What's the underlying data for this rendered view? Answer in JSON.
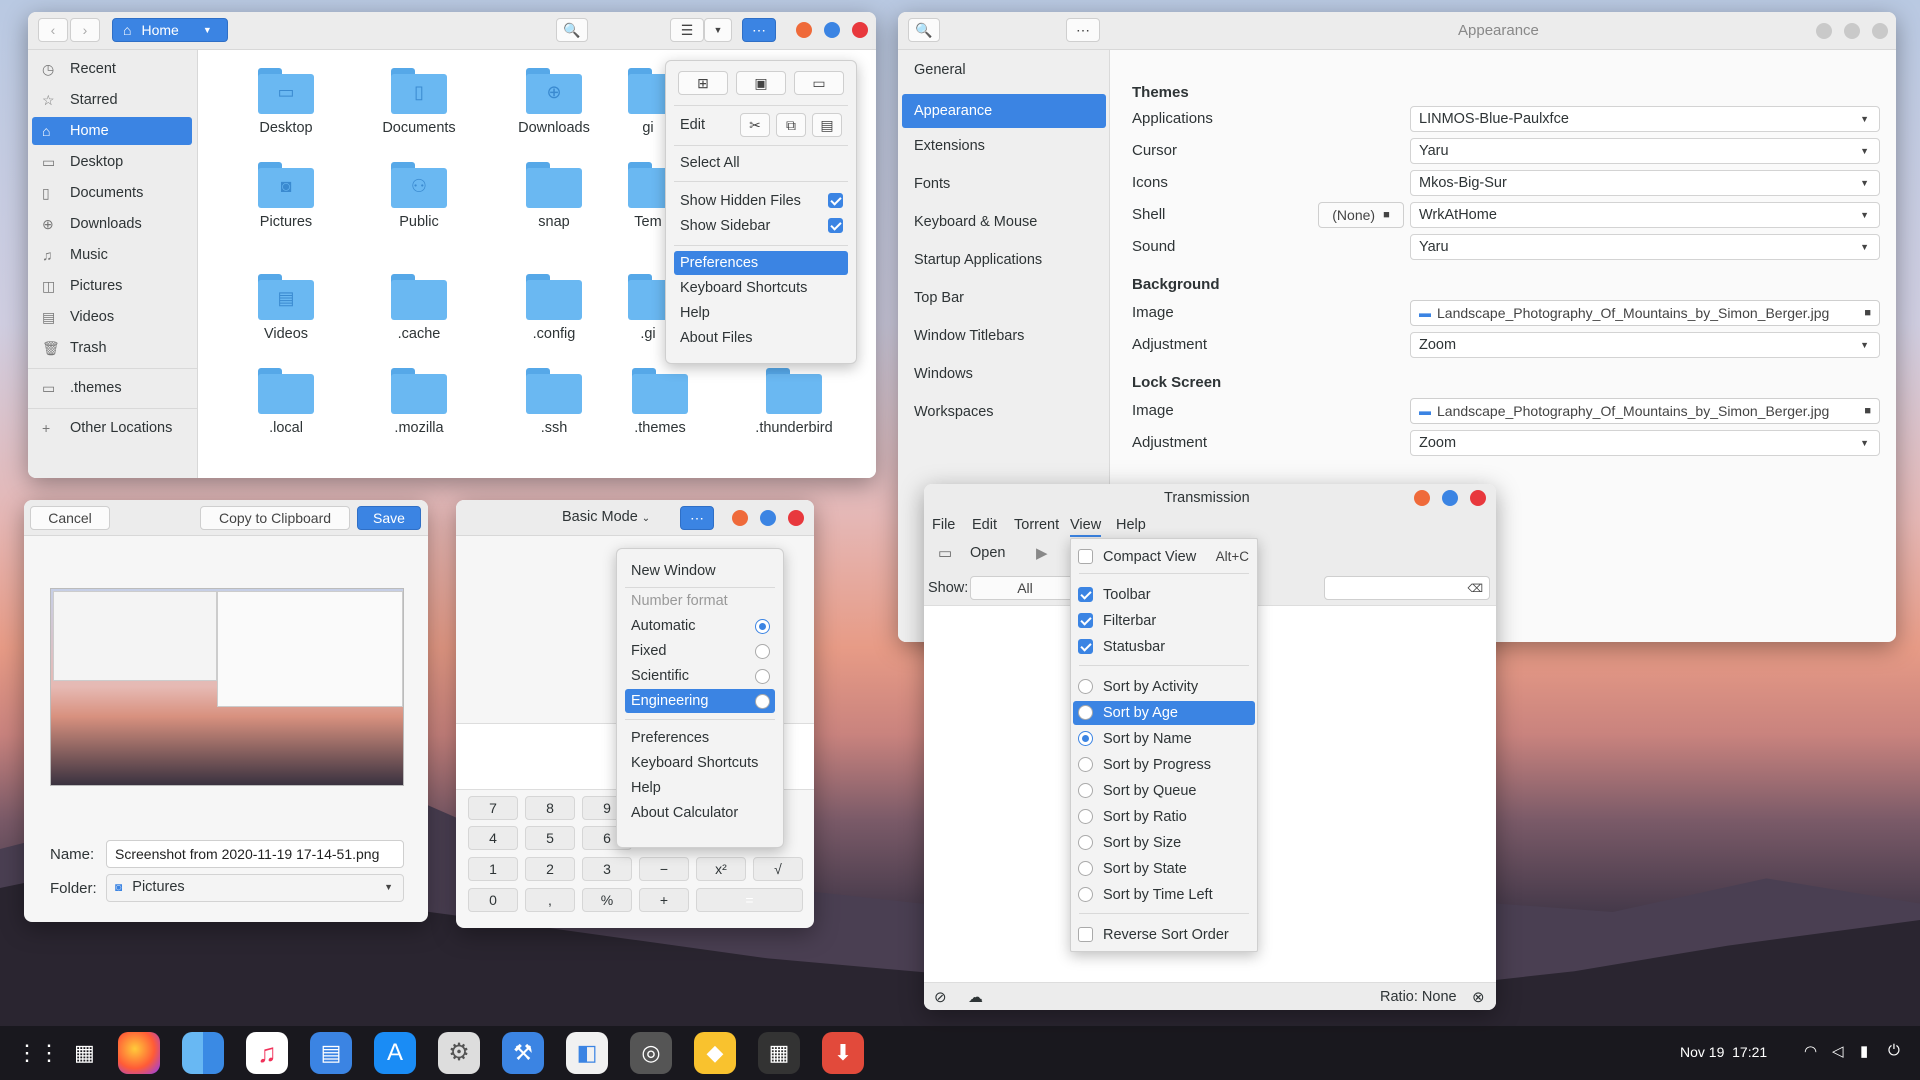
{
  "files": {
    "path_label": "Home",
    "sidebar": [
      {
        "icon": "clock-icon",
        "label": "Recent"
      },
      {
        "icon": "star-icon",
        "label": "Starred"
      },
      {
        "icon": "home-icon",
        "label": "Home"
      },
      {
        "icon": "desktop-icon",
        "label": "Desktop"
      },
      {
        "icon": "document-icon",
        "label": "Documents"
      },
      {
        "icon": "download-icon",
        "label": "Downloads"
      },
      {
        "icon": "music-icon",
        "label": "Music"
      },
      {
        "icon": "camera-icon",
        "label": "Pictures"
      },
      {
        "icon": "film-icon",
        "label": "Videos"
      },
      {
        "icon": "trash-icon",
        "label": "Trash"
      },
      {
        "icon": "folder-icon",
        "label": ".themes"
      },
      {
        "icon": "plus-icon",
        "label": "Other Locations"
      }
    ],
    "folders": [
      "Desktop",
      "Documents",
      "Downloads",
      "gi",
      "Pictures",
      "Public",
      "snap",
      "Tem",
      "Videos",
      ".cache",
      ".config",
      ".gi",
      ".local",
      ".mozilla",
      ".ssh",
      ".themes",
      ".thunderbird"
    ],
    "menu": {
      "edit": "Edit",
      "select_all": "Select All",
      "show_hidden": "Show Hidden Files",
      "show_sidebar": "Show Sidebar",
      "preferences": "Preferences",
      "shortcuts": "Keyboard Shortcuts",
      "help": "Help",
      "about": "About Files"
    }
  },
  "appearance": {
    "title": "Appearance",
    "nav": [
      "General",
      "Appearance",
      "Extensions",
      "Fonts",
      "Keyboard & Mouse",
      "Startup Applications",
      "Top Bar",
      "Window Titlebars",
      "Windows",
      "Workspaces"
    ],
    "themes_heading": "Themes",
    "applications_label": "Applications",
    "applications_value": "LINMOS-Blue-Paulxfce",
    "cursor_label": "Cursor",
    "cursor_value": "Yaru",
    "icons_label": "Icons",
    "icons_value": "Mkos-Big-Sur",
    "shell_label": "Shell",
    "shell_none": "(None)",
    "shell_value": "WrkAtHome",
    "sound_label": "Sound",
    "sound_value": "Yaru",
    "background_heading": "Background",
    "bg_image_label": "Image",
    "bg_image_value": "Landscape_Photography_Of_Mountains_by_Simon_Berger.jpg",
    "bg_adj_label": "Adjustment",
    "bg_adj_value": "Zoom",
    "lock_heading": "Lock Screen",
    "lock_image_label": "Image",
    "lock_image_value": "Landscape_Photography_Of_Mountains_by_Simon_Berger.jpg",
    "lock_adj_label": "Adjustment",
    "lock_adj_value": "Zoom"
  },
  "screenshot": {
    "cancel": "Cancel",
    "copy": "Copy to Clipboard",
    "save": "Save",
    "name_label": "Name:",
    "name_value": "Screenshot from 2020-11-19 17-14-51.png",
    "folder_label": "Folder:",
    "folder_value": "Pictures"
  },
  "calculator": {
    "mode": "Basic Mode",
    "menu": {
      "new_window": "New Window",
      "number_format": "Number format",
      "automatic": "Automatic",
      "fixed": "Fixed",
      "scientific": "Scientific",
      "engineering": "Engineering",
      "preferences": "Preferences",
      "shortcuts": "Keyboard Shortcuts",
      "help": "Help",
      "about": "About Calculator"
    },
    "keys": {
      "k7": "7",
      "k8": "8",
      "k9": "9",
      "k4": "4",
      "k5": "5",
      "k6": "6",
      "k1": "1",
      "k2": "2",
      "k3": "3",
      "minus": "−",
      "sq": "x²",
      "sqrt": "√",
      "k0": "0",
      "dot": ",",
      "pct": "%",
      "plus": "+",
      "eq": "="
    }
  },
  "transmission": {
    "title": "Transmission",
    "menubar": [
      "File",
      "Edit",
      "Torrent",
      "View",
      "Help"
    ],
    "open": "Open",
    "show_label": "Show:",
    "show_value": "All",
    "ratio": "Ratio: None",
    "view_menu": {
      "compact": "Compact View",
      "compact_shortcut": "Alt+C",
      "toolbar": "Toolbar",
      "filterbar": "Filterbar",
      "statusbar": "Statusbar",
      "sorts": [
        "Sort by Activity",
        "Sort by Age",
        "Sort by Name",
        "Sort by Progress",
        "Sort by Queue",
        "Sort by Ratio",
        "Sort by Size",
        "Sort by State",
        "Sort by Time Left"
      ],
      "reverse": "Reverse Sort Order"
    }
  },
  "taskbar": {
    "clock": "Nov 19  17:21"
  }
}
